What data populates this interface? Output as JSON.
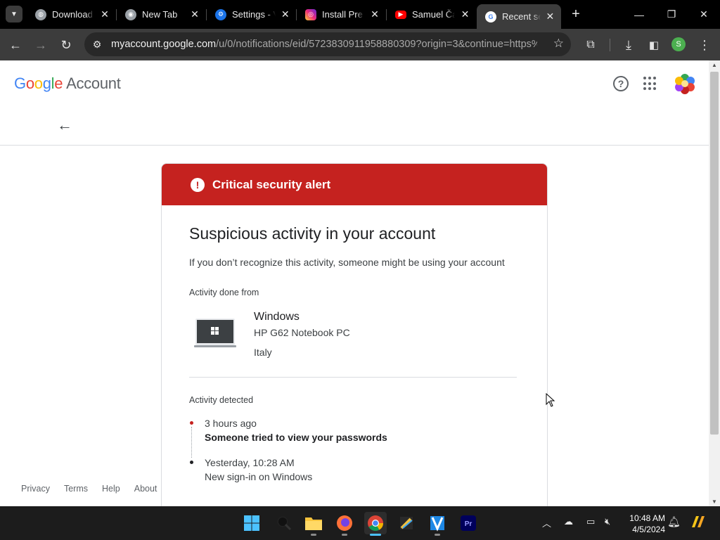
{
  "tabs": [
    {
      "title": "Download",
      "favicon": "globe-icon"
    },
    {
      "title": "New Tab",
      "favicon": "chrome-icon"
    },
    {
      "title": "Settings - V",
      "favicon": "settings-gear-icon"
    },
    {
      "title": "Install Pre",
      "favicon": "instagram-icon"
    },
    {
      "title": "Samuel Ča",
      "favicon": "youtube-icon"
    },
    {
      "title": "Recent sec",
      "favicon": "google-icon"
    }
  ],
  "toolbar": {
    "url_host": "myaccount.google.com",
    "url_path": "/u/0/notifications/eid/5723830911958880309?origin=3&continue=https%...",
    "profile_initial": "S"
  },
  "header": {
    "logo_letters": [
      "G",
      "o",
      "o",
      "g",
      "l",
      "e"
    ],
    "logo_suffix": "Account"
  },
  "alert": {
    "title": "Critical security alert",
    "heading": "Suspicious activity in your account",
    "subtitle": "If you don’t recognize this activity, someone might be using your account",
    "done_from_label": "Activity done from",
    "device": {
      "os": "Windows",
      "model": "HP G62 Notebook PC",
      "location": "Italy"
    },
    "detected_label": "Activity detected",
    "events": [
      {
        "time": "3 hours ago",
        "description": "Someone tried to view your passwords",
        "color": "#c5221f"
      },
      {
        "time": "Yesterday, 10:28 AM",
        "description": "New sign-in on Windows",
        "color": "#202124"
      }
    ]
  },
  "footer": {
    "links": [
      "Privacy",
      "Terms",
      "Help",
      "About"
    ]
  },
  "taskbar": {
    "time": "10:48 AM",
    "date": "4/5/2024"
  },
  "colors": {
    "alert_red": "#c5221f",
    "chrome_dark": "#3c3c3c",
    "taskbar": "#1c1c1c"
  }
}
